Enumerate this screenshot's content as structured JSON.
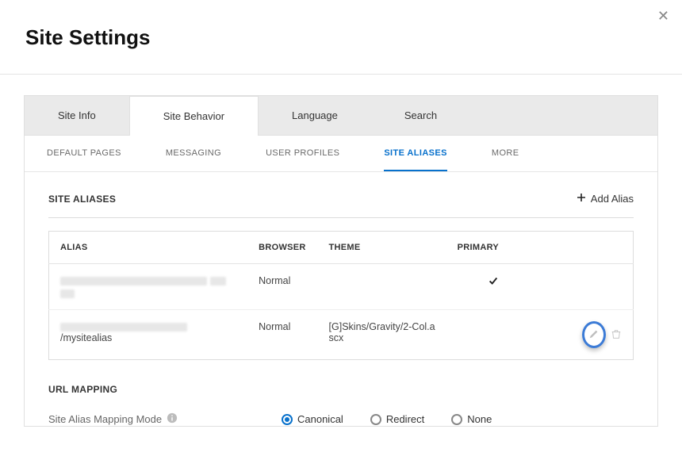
{
  "page": {
    "title": "Site Settings"
  },
  "tabsPrimary": [
    {
      "label": "Site Info"
    },
    {
      "label": "Site Behavior"
    },
    {
      "label": "Language"
    },
    {
      "label": "Search"
    }
  ],
  "tabsSecondary": [
    {
      "label": "DEFAULT PAGES"
    },
    {
      "label": "MESSAGING"
    },
    {
      "label": "USER PROFILES"
    },
    {
      "label": "SITE ALIASES"
    },
    {
      "label": "MORE"
    }
  ],
  "section": {
    "title": "SITE ALIASES",
    "addLabel": "Add Alias"
  },
  "tableHeaders": {
    "alias": "ALIAS",
    "browser": "BROWSER",
    "theme": "THEME",
    "primary": "PRIMARY"
  },
  "rows": [
    {
      "aliasVisible": "",
      "aliasVisibleSuffix": "",
      "browser": "Normal",
      "theme": "",
      "primary": true
    },
    {
      "aliasVisible": "",
      "aliasVisibleSuffix": "/mysitealias",
      "browser": "Normal",
      "theme": "[G]Skins/Gravity/2-Col.ascx",
      "primary": false
    }
  ],
  "urlMapping": {
    "title": "URL MAPPING",
    "modeLabel": "Site Alias Mapping Mode",
    "options": [
      {
        "label": "Canonical",
        "selected": true
      },
      {
        "label": "Redirect",
        "selected": false
      },
      {
        "label": "None",
        "selected": false
      }
    ]
  }
}
